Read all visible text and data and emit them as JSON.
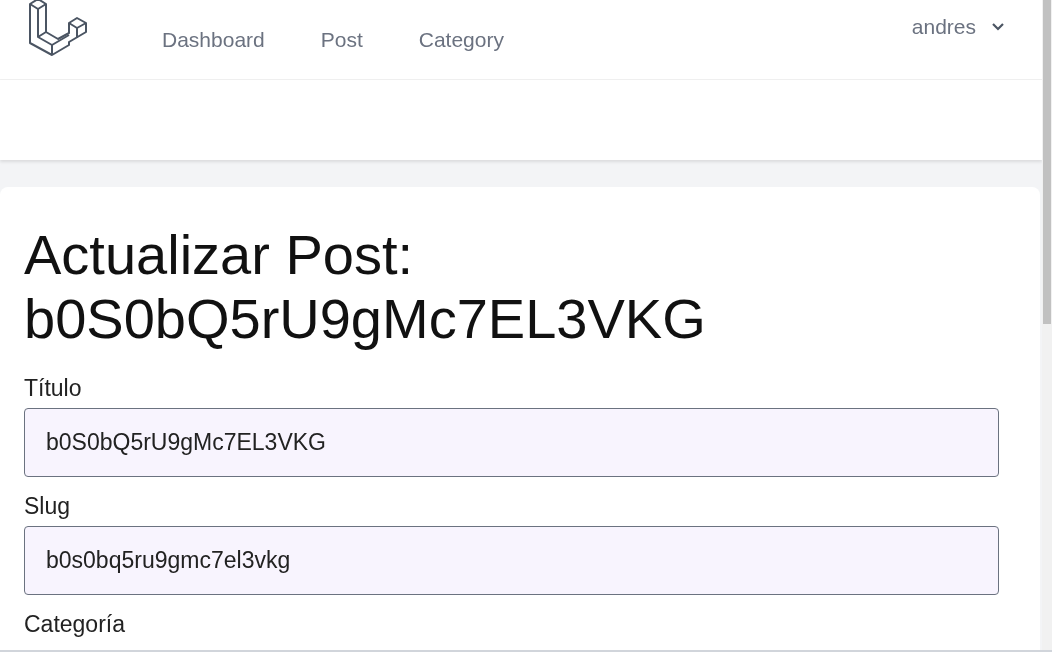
{
  "nav": {
    "links": [
      {
        "label": "Dashboard"
      },
      {
        "label": "Post"
      },
      {
        "label": "Category"
      }
    ],
    "user": {
      "name": "andres"
    }
  },
  "page": {
    "title": "Actualizar Post: b0S0bQ5rU9gMc7EL3VKG"
  },
  "form": {
    "fields": [
      {
        "label": "Título",
        "value": "b0S0bQ5rU9gMc7EL3VKG"
      },
      {
        "label": "Slug",
        "value": "b0s0bq5ru9gmc7el3vkg"
      },
      {
        "label": "Categoría"
      }
    ]
  }
}
